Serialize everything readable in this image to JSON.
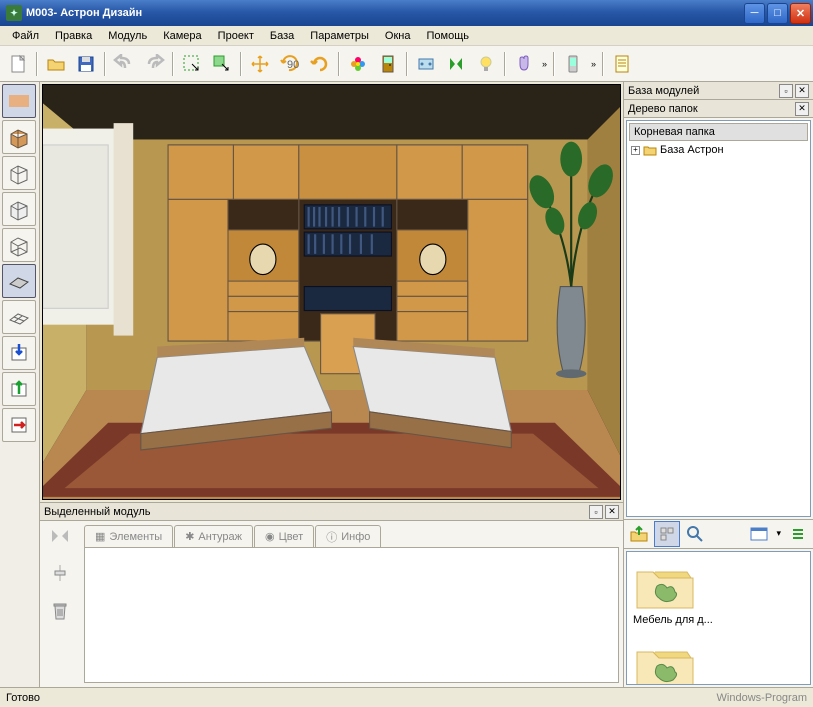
{
  "titlebar": {
    "text": "M003- Астрон Дизайн"
  },
  "menu": {
    "items": [
      "Файл",
      "Правка",
      "Модуль",
      "Камера",
      "Проект",
      "База",
      "Параметры",
      "Окна",
      "Помощь"
    ]
  },
  "toolbar": {
    "icons": [
      "new",
      "open",
      "save",
      "undo",
      "redo",
      "select-rect",
      "select-cursor",
      "move",
      "rotate90",
      "rotate",
      "flower",
      "door",
      "module",
      "mirror",
      "bulb",
      "hand",
      "phone",
      "doc"
    ]
  },
  "left_tools": {
    "items": [
      "wall-solid",
      "box",
      "wireframe-box",
      "box2",
      "wireframe-box2",
      "plane",
      "plane-wire",
      "import",
      "export",
      "arrow-right"
    ]
  },
  "bottom_panel": {
    "title": "Выделенный модуль",
    "tabs": [
      "Элементы",
      "Антураж",
      "Цвет",
      "Инфо"
    ]
  },
  "right_panel": {
    "title1": "База модулей",
    "title2": "Дерево папок",
    "root_label": "Корневая папка",
    "tree_item": "База Астрон",
    "thumb1_label": "Мебель для д..."
  },
  "status": {
    "text": "Готово",
    "watermark": "Windows-Program"
  }
}
